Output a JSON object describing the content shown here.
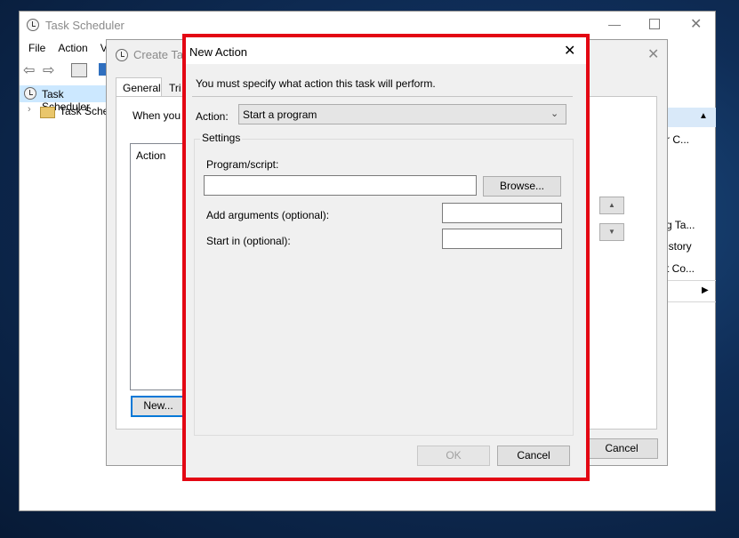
{
  "task_scheduler": {
    "title": "Task Scheduler",
    "menu": [
      "File",
      "Action",
      "V"
    ],
    "tree": [
      "Task Scheduler",
      "Task Sched"
    ],
    "right_panel": [
      "r C...",
      "g Ta...",
      "istory",
      "t Co..."
    ],
    "cancel_label": "Cancel"
  },
  "create_task": {
    "title": "Create Tas",
    "tabs": [
      "General",
      "Tri"
    ],
    "prompt": "When you",
    "list_header": "Action",
    "new_button": "New..."
  },
  "new_action": {
    "title": "New Action",
    "instruction": "You must specify what action this task will perform.",
    "action_label": "Action:",
    "action_value": "Start a program",
    "settings_label": "Settings",
    "program_label": "Program/script:",
    "program_value": "",
    "browse_label": "Browse...",
    "arguments_label": "Add arguments (optional):",
    "arguments_value": "",
    "start_in_label": "Start in (optional):",
    "start_in_value": "",
    "ok_label": "OK",
    "cancel_label": "Cancel"
  },
  "colors": {
    "highlight_border": "#e30613",
    "selection": "#cce8ff",
    "focus_border": "#0078d7"
  }
}
